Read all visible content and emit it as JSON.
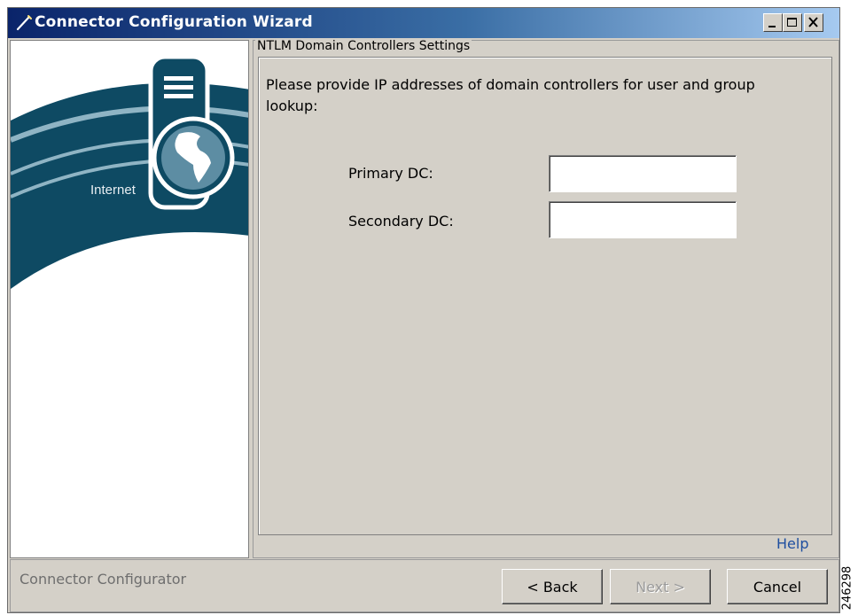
{
  "window": {
    "title": "Connector Configuration Wizard"
  },
  "left_graphic": {
    "label": "Internet",
    "colors": {
      "band": "#0e4a63",
      "arc": "#8fb4c4"
    }
  },
  "section": {
    "legend": "NTLM Domain Controllers Settings",
    "instructions": "Please provide IP addresses of domain controllers for user and group lookup:"
  },
  "fields": {
    "primary": {
      "label": "Primary DC:",
      "value": ""
    },
    "secondary": {
      "label": "Secondary DC:",
      "value": ""
    }
  },
  "help_link": "Help",
  "footer": {
    "status": "Connector Configurator",
    "back_label": "< Back",
    "next_label": "Next >",
    "cancel_label": "Cancel"
  },
  "figure_code": "246298"
}
